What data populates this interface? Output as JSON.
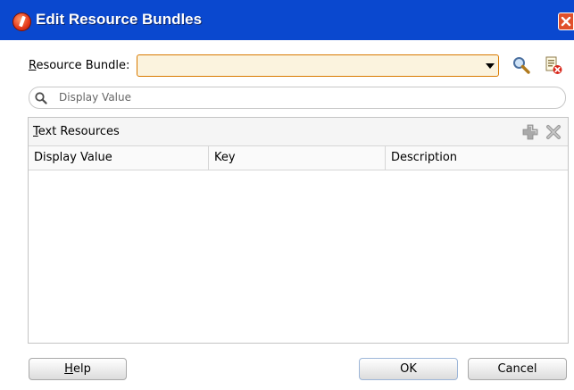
{
  "window": {
    "title": "Edit Resource Bundles"
  },
  "resource_bundle": {
    "label_first": "R",
    "label_rest": "esource Bundle:",
    "value": ""
  },
  "search": {
    "placeholder": "Display Value"
  },
  "panel": {
    "title_first": "T",
    "title_rest": "ext Resources"
  },
  "table": {
    "columns": [
      "Display Value",
      "Key",
      "Description"
    ],
    "rows": []
  },
  "buttons": {
    "help_first": "H",
    "help_rest": "elp",
    "ok": "OK",
    "cancel": "Cancel"
  },
  "icons": {
    "app": "oracle-logo-icon",
    "close": "close-icon",
    "browse": "magnifier-icon",
    "delete_bundle": "delete-bundle-icon",
    "search": "search-icon",
    "add": "add-icon",
    "remove": "remove-icon"
  },
  "colors": {
    "title_bar": "#0a48cf",
    "combo_border": "#d97a00",
    "combo_fill": "#fbf3de"
  }
}
